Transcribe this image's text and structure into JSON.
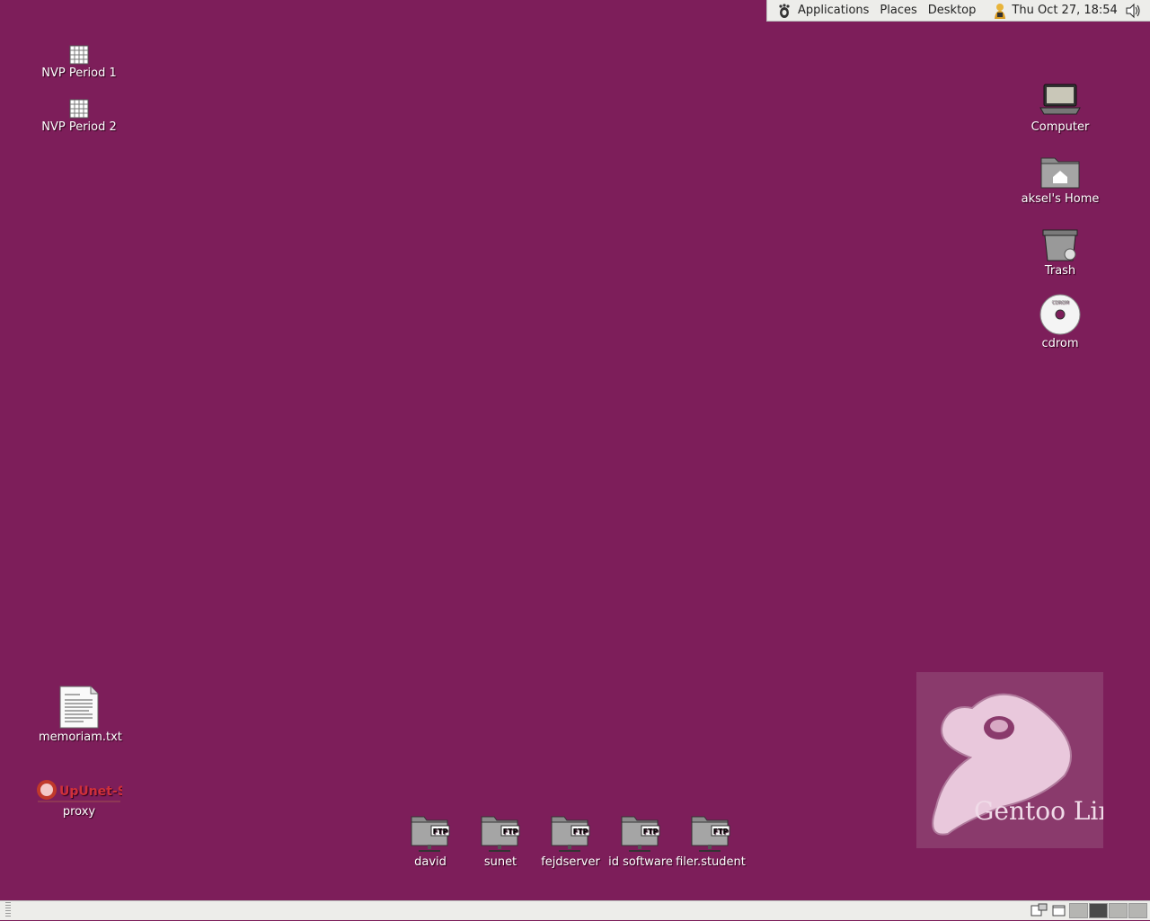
{
  "panel": {
    "menus": [
      "Applications",
      "Places",
      "Desktop"
    ],
    "clock": "Thu Oct 27, 18:54"
  },
  "desktop_icons_left": [
    {
      "label": "NVP Period 1",
      "icon": "spreadsheet-icon"
    },
    {
      "label": "NVP Period 2",
      "icon": "spreadsheet-icon"
    },
    {
      "label": "memoriam.txt",
      "icon": "text-file-icon"
    },
    {
      "label": "proxy",
      "icon": "upunet-logo-icon",
      "logo_text": "UpUnet-S"
    }
  ],
  "desktop_icons_right": [
    {
      "label": "Computer",
      "icon": "computer-icon"
    },
    {
      "label": "aksel's Home",
      "icon": "home-folder-icon"
    },
    {
      "label": "Trash",
      "icon": "trash-icon"
    },
    {
      "label": "cdrom",
      "icon": "cdrom-icon",
      "disc_text": "CDROM"
    }
  ],
  "ftp_shares": [
    "david",
    "sunet",
    "fejdserver",
    "id software",
    "filer.student"
  ],
  "ftp_badge": "FTP",
  "wallpaper": {
    "logo_text": "Gentoo Linux"
  },
  "colors": {
    "background": "#7d1e5a",
    "panel": "#ededea"
  }
}
